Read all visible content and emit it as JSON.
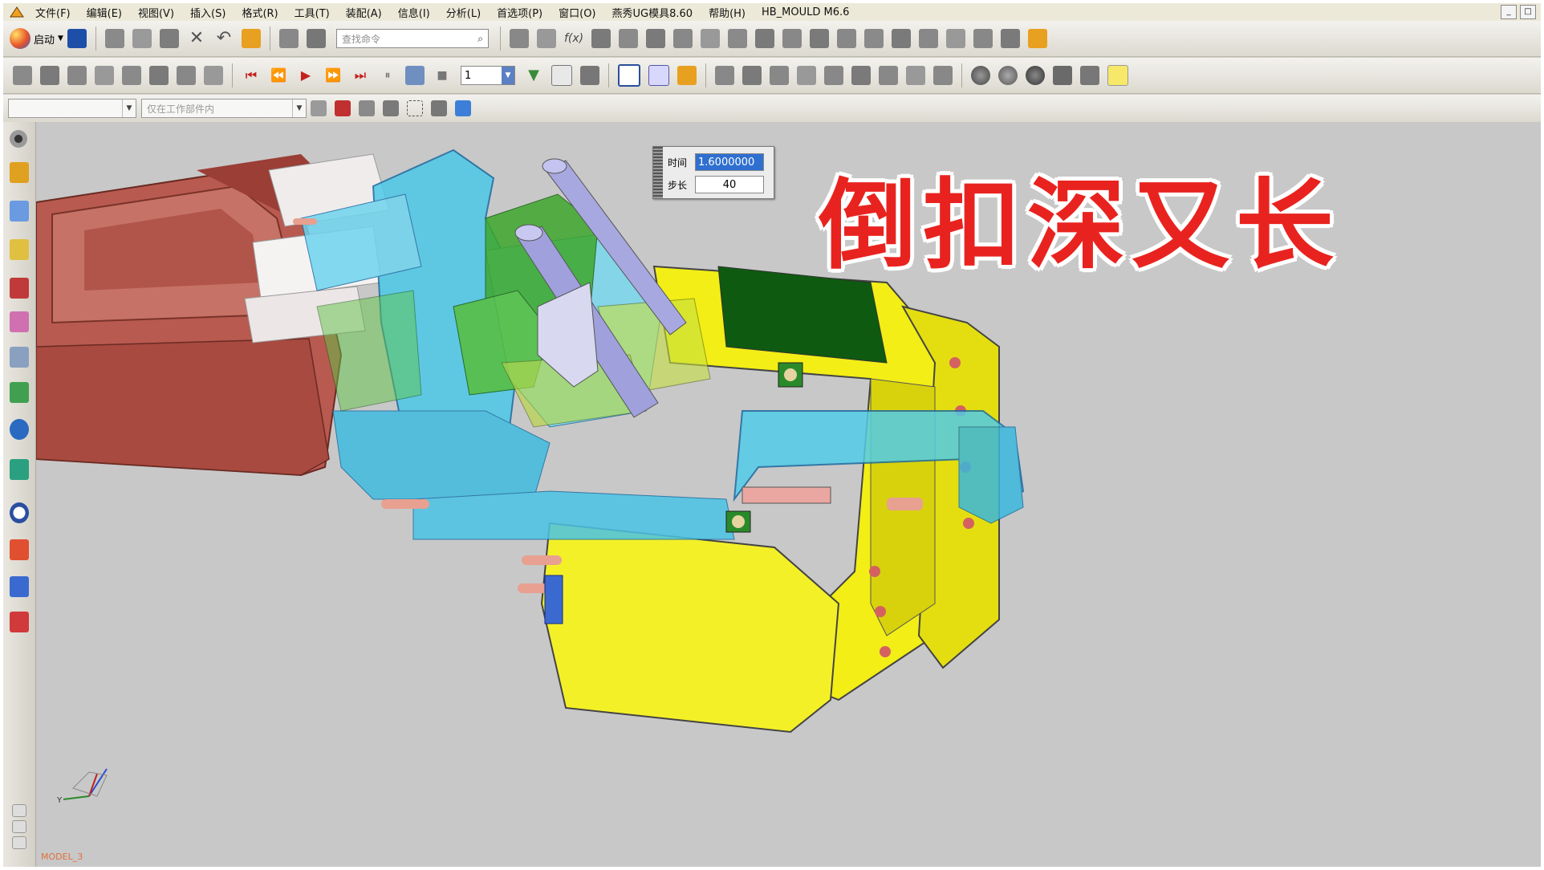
{
  "menu": {
    "items": [
      "文件(F)",
      "编辑(E)",
      "视图(V)",
      "插入(S)",
      "格式(R)",
      "工具(T)",
      "装配(A)",
      "信息(I)",
      "分析(L)",
      "首选项(P)",
      "窗口(O)",
      "燕秀UG模具8.60",
      "帮助(H)",
      "HB_MOULD M6.6"
    ],
    "window_controls": [
      "_",
      "□"
    ]
  },
  "toolbar": {
    "start_label": "启动",
    "search_placeholder": "查找命令",
    "layer_value": "1",
    "work_part_filter": "仅在工作部件内"
  },
  "animation_dialog": {
    "time_label": "时间",
    "time_value": "1.6000000",
    "step_label": "步长",
    "step_value": "40"
  },
  "caption": "倒扣深又长",
  "viewport": {
    "model_label": "MODEL_3"
  },
  "colors": {
    "caption": "#e8231f",
    "background": "#c8c8c8",
    "plastic_part": "#b85a50",
    "mold_base": "#f2ee16",
    "slider": "#4cc8e8",
    "core": "#3ea82c",
    "cylinder": "#a8a8e0"
  }
}
